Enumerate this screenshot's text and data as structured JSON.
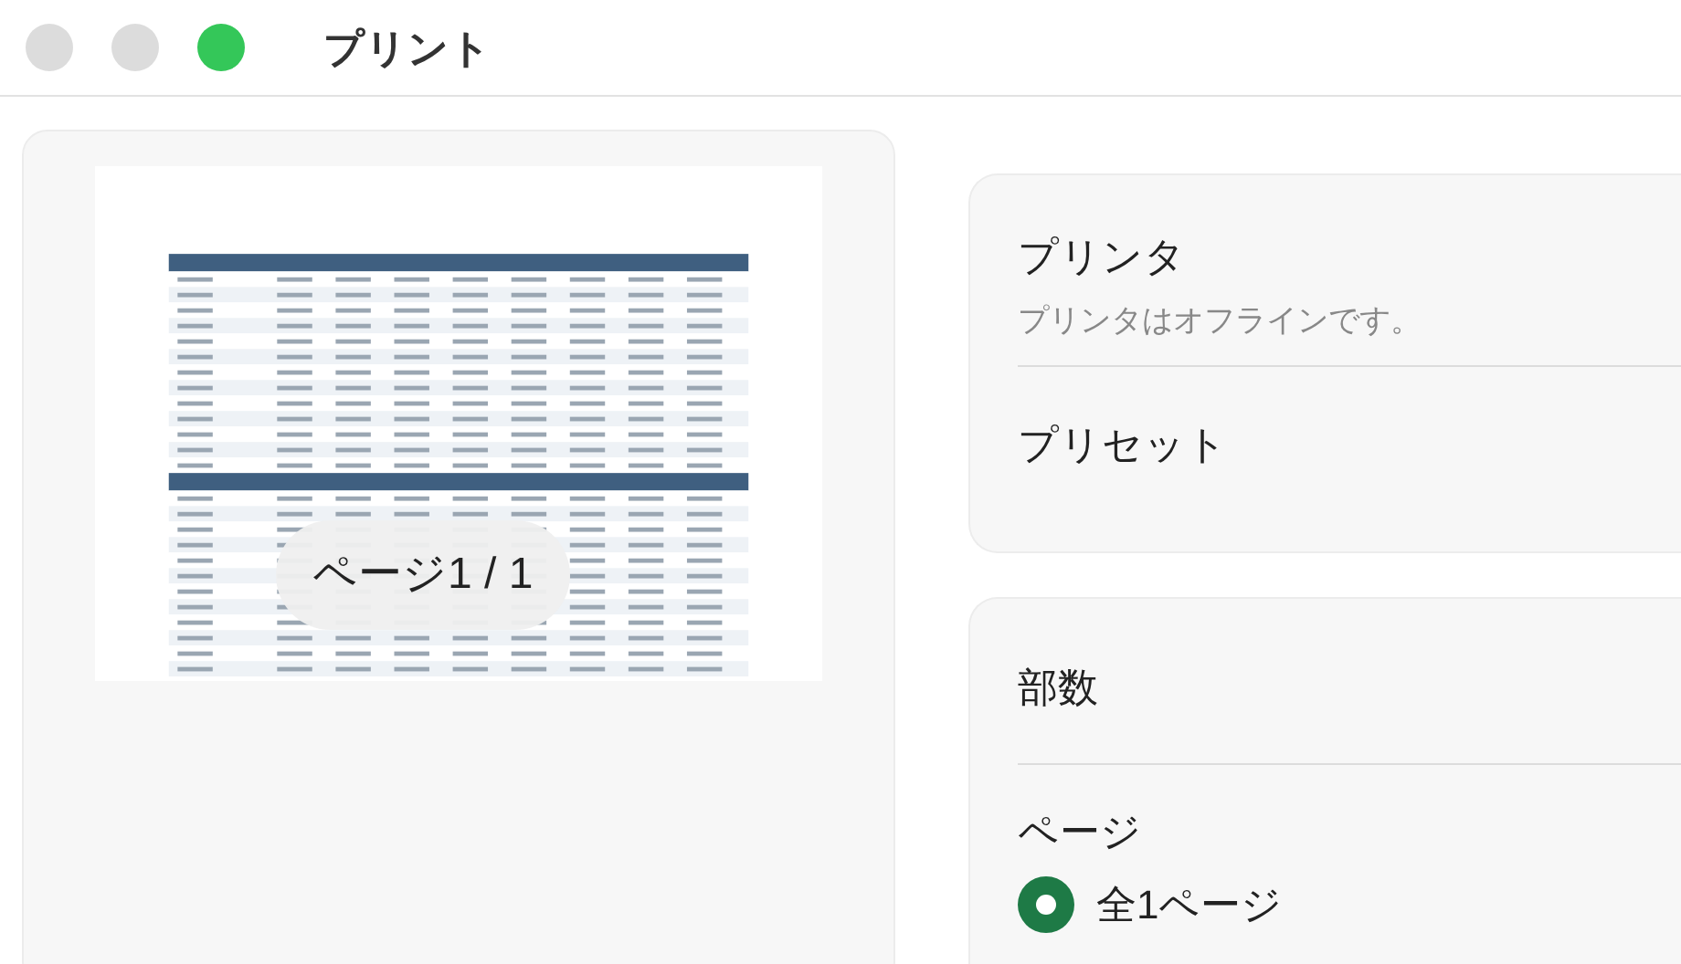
{
  "window": {
    "title": "プリント",
    "controls": [
      {
        "kind": "close"
      },
      {
        "kind": "minimize"
      },
      {
        "kind": "zoom"
      }
    ]
  },
  "preview": {
    "page_indicator": "ページ1 / 1"
  },
  "printer_card": {
    "printer_label": "プリンタ",
    "printer_status": "プリンタはオフラインです。",
    "preset_label": "プリセット"
  },
  "copies_card": {
    "copies_label": "部数",
    "pages_label": "ページ",
    "page_options": [
      {
        "label": "全1ページ",
        "selected": true
      }
    ]
  }
}
